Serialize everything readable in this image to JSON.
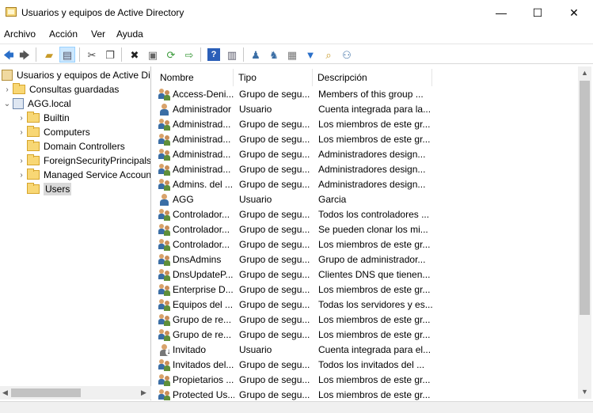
{
  "window": {
    "title": "Usuarios y equipos de Active Directory",
    "minimize": "—",
    "maximize": "☐",
    "close": "✕"
  },
  "menu": [
    "Archivo",
    "Acción",
    "Ver",
    "Ayuda"
  ],
  "toolbar_icons": [
    "back-arrow-icon",
    "forward-arrow-icon",
    "up-folder-icon",
    "show-console-tree-icon",
    "cut-icon",
    "copy-icon",
    "delete-icon",
    "properties-icon",
    "refresh-icon",
    "export-list-icon",
    "help-icon",
    "action-pane-icon",
    "new-user-icon",
    "new-group-icon",
    "new-ou-icon",
    "filter-icon",
    "find-icon",
    "add-to-group-icon"
  ],
  "tree": {
    "root": "Usuarios y equipos de Active Directory",
    "saved_queries": "Consultas guardadas",
    "domain": "AGG.local",
    "children": [
      "Builtin",
      "Computers",
      "Domain Controllers",
      "ForeignSecurityPrincipals",
      "Managed Service Accounts",
      "Users"
    ],
    "selected": "Users"
  },
  "list": {
    "columns": [
      "Nombre",
      "Tipo",
      "Descripción"
    ],
    "rows": [
      {
        "name": "Access-Deni...",
        "type": "Grupo de segu...",
        "desc": "Members of this group ...",
        "icon": "group"
      },
      {
        "name": "Administrador",
        "type": "Usuario",
        "desc": "Cuenta integrada para la...",
        "icon": "user"
      },
      {
        "name": "Administrad...",
        "type": "Grupo de segu...",
        "desc": "Los miembros de este gr...",
        "icon": "group"
      },
      {
        "name": "Administrad...",
        "type": "Grupo de segu...",
        "desc": "Los miembros de este gr...",
        "icon": "group"
      },
      {
        "name": "Administrad...",
        "type": "Grupo de segu...",
        "desc": "Administradores design...",
        "icon": "group"
      },
      {
        "name": "Administrad...",
        "type": "Grupo de segu...",
        "desc": "Administradores design...",
        "icon": "group"
      },
      {
        "name": "Admins. del ...",
        "type": "Grupo de segu...",
        "desc": "Administradores design...",
        "icon": "group"
      },
      {
        "name": "AGG",
        "type": "Usuario",
        "desc": "Garcia",
        "icon": "user"
      },
      {
        "name": "Controlador...",
        "type": "Grupo de segu...",
        "desc": "Todos los controladores ...",
        "icon": "group"
      },
      {
        "name": "Controlador...",
        "type": "Grupo de segu...",
        "desc": "Se pueden clonar los mi...",
        "icon": "group"
      },
      {
        "name": "Controlador...",
        "type": "Grupo de segu...",
        "desc": "Los miembros de este gr...",
        "icon": "group"
      },
      {
        "name": "DnsAdmins",
        "type": "Grupo de segu...",
        "desc": "Grupo de administrador...",
        "icon": "group"
      },
      {
        "name": "DnsUpdateP...",
        "type": "Grupo de segu...",
        "desc": "Clientes DNS que tienen...",
        "icon": "group"
      },
      {
        "name": "Enterprise D...",
        "type": "Grupo de segu...",
        "desc": "Los miembros de este gr...",
        "icon": "group"
      },
      {
        "name": "Equipos del ...",
        "type": "Grupo de segu...",
        "desc": "Todas los servidores y es...",
        "icon": "group"
      },
      {
        "name": "Grupo de re...",
        "type": "Grupo de segu...",
        "desc": "Los miembros de este gr...",
        "icon": "group"
      },
      {
        "name": "Grupo de re...",
        "type": "Grupo de segu...",
        "desc": "Los miembros de este gr...",
        "icon": "group"
      },
      {
        "name": "Invitado",
        "type": "Usuario",
        "desc": "Cuenta integrada para el...",
        "icon": "user-disabled"
      },
      {
        "name": "Invitados del...",
        "type": "Grupo de segu...",
        "desc": "Todos los invitados del ...",
        "icon": "group"
      },
      {
        "name": "Propietarios ...",
        "type": "Grupo de segu...",
        "desc": "Los miembros de este gr...",
        "icon": "group"
      },
      {
        "name": "Protected Us...",
        "type": "Grupo de segu...",
        "desc": "Los miembros de este gr...",
        "icon": "group"
      }
    ]
  }
}
